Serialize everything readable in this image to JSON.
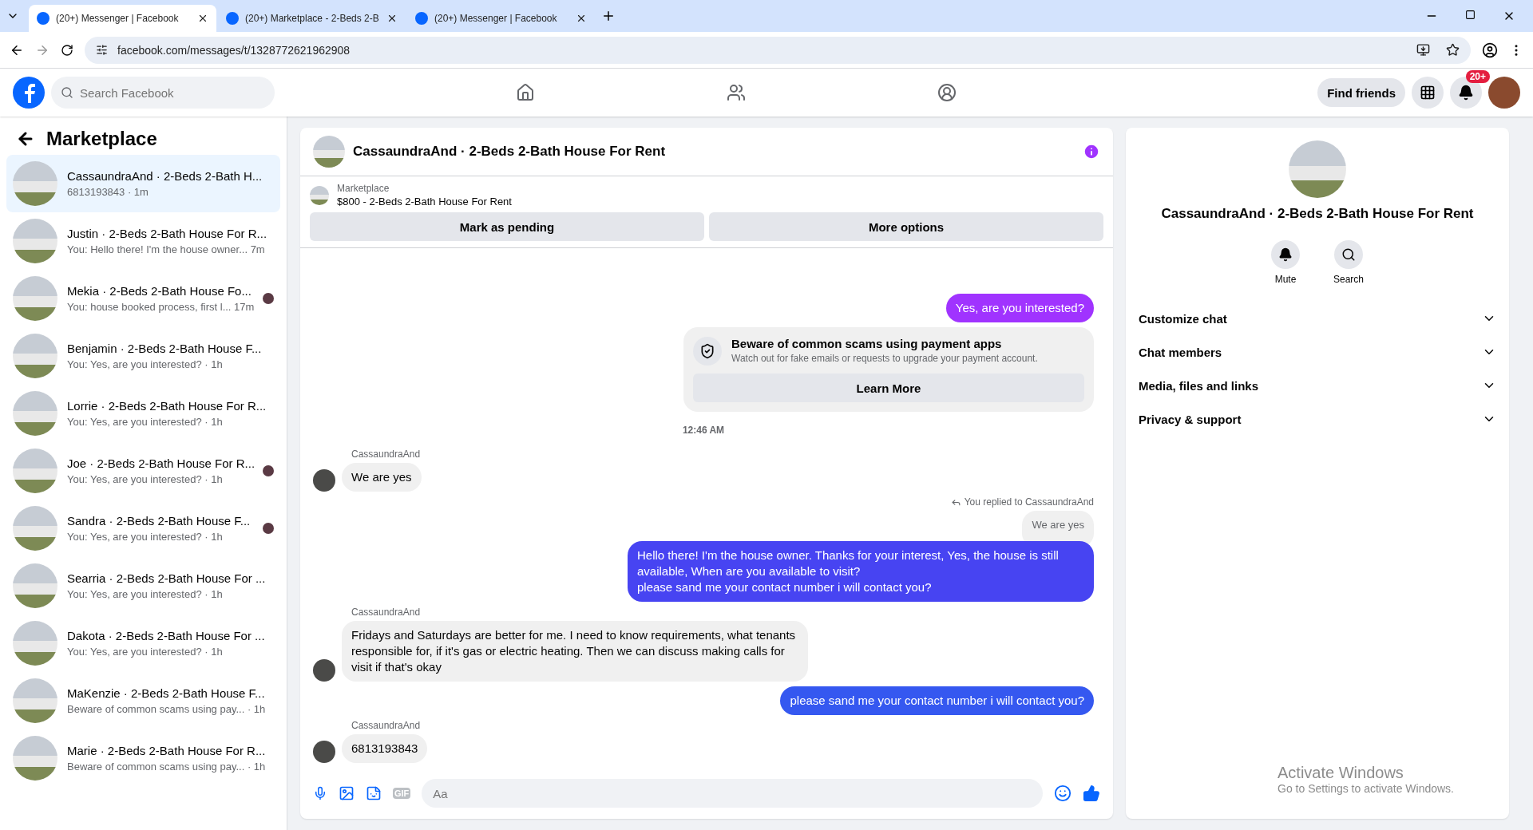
{
  "browser": {
    "tabs": [
      {
        "title": "(20+) Messenger | Facebook",
        "selected": true
      },
      {
        "title": "(20+) Marketplace - 2-Beds 2-B",
        "selected": false
      },
      {
        "title": "(20+) Messenger | Facebook",
        "selected": false
      }
    ],
    "url": "facebook.com/messages/t/1328772621962908"
  },
  "header": {
    "search_placeholder": "Search Facebook",
    "find_friends": "Find friends",
    "notification_badge": "20+"
  },
  "sidebar": {
    "title": "Marketplace",
    "items": [
      {
        "name": "CassaundraAnd · 2-Beds 2-Bath H...",
        "preview": "6813193843 · 1m",
        "selected": true,
        "read_receipt": false
      },
      {
        "name": "Justin · 2-Beds 2-Bath House For R...",
        "preview": "You: Hello there! I'm the house owner... 7m",
        "selected": false,
        "read_receipt": false
      },
      {
        "name": "Mekia · 2-Beds 2-Bath House Fo...",
        "preview": "You: house booked process, first l... 17m",
        "selected": false,
        "read_receipt": true
      },
      {
        "name": "Benjamin · 2-Beds 2-Bath House F...",
        "preview": "You: Yes, are you interested? · 1h",
        "selected": false,
        "read_receipt": false
      },
      {
        "name": "Lorrie · 2-Beds 2-Bath House For R...",
        "preview": "You: Yes, are you interested? · 1h",
        "selected": false,
        "read_receipt": false
      },
      {
        "name": "Joe · 2-Beds 2-Bath House For R...",
        "preview": "You: Yes, are you interested? · 1h",
        "selected": false,
        "read_receipt": true
      },
      {
        "name": "Sandra · 2-Beds 2-Bath House F...",
        "preview": "You: Yes, are you interested? · 1h",
        "selected": false,
        "read_receipt": true
      },
      {
        "name": "Searria · 2-Beds 2-Bath House For ...",
        "preview": "You: Yes, are you interested? · 1h",
        "selected": false,
        "read_receipt": false
      },
      {
        "name": "Dakota · 2-Beds 2-Bath House For ...",
        "preview": "You: Yes, are you interested? · 1h",
        "selected": false,
        "read_receipt": false
      },
      {
        "name": "MaKenzie · 2-Beds 2-Bath House F...",
        "preview": "Beware of common scams using pay...  · 1h",
        "selected": false,
        "read_receipt": false
      },
      {
        "name": "Marie · 2-Beds 2-Bath House For R...",
        "preview": "Beware of common scams using pay...  · 1h",
        "selected": false,
        "read_receipt": false
      }
    ]
  },
  "chat": {
    "title": "CassaundraAnd · 2-Beds 2-Bath House For Rent",
    "listing": {
      "label": "Marketplace",
      "price_title": "$800 - 2-Beds 2-Bath House For Rent"
    },
    "actions": [
      "Mark as pending",
      "More options"
    ],
    "messages": [
      {
        "kind": "outgoing",
        "text": "Yes, are you interested?",
        "color": "#a033ff"
      },
      {
        "kind": "notice",
        "title": "Beware of common scams using payment apps",
        "text": "Watch out for fake emails or requests to upgrade your payment account.",
        "button": "Learn More"
      },
      {
        "kind": "time",
        "text": "12:46 AM"
      },
      {
        "kind": "incoming",
        "sender": "CassaundraAnd",
        "text": "We are yes"
      },
      {
        "kind": "reply",
        "note": "You replied to CassaundraAnd",
        "quote": "We are yes"
      },
      {
        "kind": "outgoing",
        "text": "Hello there! I'm the house owner. Thanks for your interest, Yes, the house is still available, When are you available to visit?\nplease sand me your contact number i will contact you?",
        "color": "#4744f2"
      },
      {
        "kind": "incoming",
        "sender": "CassaundraAnd",
        "text": "Fridays and Saturdays are better for me. I need to know requirements, what tenants responsible for, if it's gas or electric heating. Then we can discuss making calls for visit if that's okay"
      },
      {
        "kind": "outgoing",
        "text": "please sand me your contact number i will contact you?",
        "color": "#3558f0"
      },
      {
        "kind": "incoming",
        "sender": "CassaundraAnd",
        "text": "6813193843"
      }
    ],
    "composer_placeholder": "Aa",
    "gif_label": "GIF"
  },
  "details": {
    "title": "CassaundraAnd · 2-Beds 2-Bath House For Rent",
    "actions": [
      "Mute",
      "Search"
    ],
    "sections": [
      "Customize chat",
      "Chat members",
      "Media, files and links",
      "Privacy & support"
    ]
  },
  "os_notice": {
    "title": "Activate Windows",
    "text": "Go to Settings to activate Windows."
  }
}
